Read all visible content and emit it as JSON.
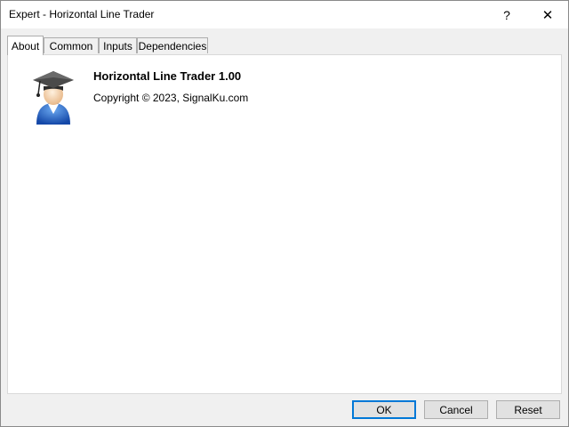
{
  "window": {
    "title": "Expert - Horizontal Line Trader",
    "help_label": "?",
    "close_label": "✕"
  },
  "tabs": [
    {
      "label": "About",
      "active": true
    },
    {
      "label": "Common"
    },
    {
      "label": "Inputs"
    },
    {
      "label": "Dependencies"
    }
  ],
  "about": {
    "icon": "graduate-icon",
    "name": "Horizontal Line Trader 1.00",
    "copyright": "Copyright © 2023, SignalKu.com"
  },
  "buttons": {
    "ok": "OK",
    "cancel": "Cancel",
    "reset": "Reset"
  },
  "colors": {
    "focus_border": "#0078d7",
    "icon_blue": "#1f63c4",
    "cap": "#3a3a3a"
  }
}
